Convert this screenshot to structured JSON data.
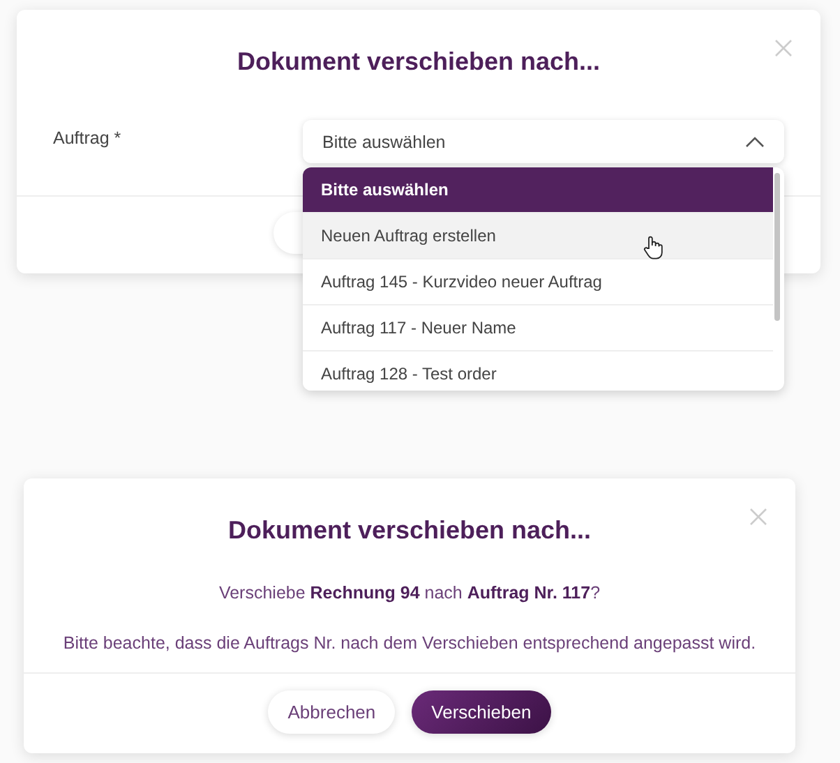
{
  "select_dialog": {
    "title": "Dokument verschieben nach...",
    "field": {
      "label": "Auftrag *",
      "value": "Bitte auswählen",
      "expanded": true
    },
    "options": [
      {
        "label": "Bitte auswählen",
        "selected": true,
        "hovered": false
      },
      {
        "label": "Neuen Auftrag erstellen",
        "selected": false,
        "hovered": true
      },
      {
        "label": "Auftrag 145 - Kurzvideo neuer Auftrag",
        "selected": false,
        "hovered": false
      },
      {
        "label": "Auftrag 117 - Neuer Name",
        "selected": false,
        "hovered": false
      },
      {
        "label": "Auftrag 128 - Test order",
        "selected": false,
        "hovered": false
      }
    ]
  },
  "confirm_dialog": {
    "title": "Dokument verschieben nach...",
    "message": "Verschiebe **Rechnung 94** nach **Auftrag Nr. 117**?",
    "note": "Bitte beachte, dass die Auftrags Nr. nach dem Verschieben entsprechend angepasst wird.",
    "buttons": [
      {
        "label": "Abbrechen",
        "kind": "secondary"
      },
      {
        "label": "Verschieben",
        "kind": "primary"
      }
    ]
  }
}
